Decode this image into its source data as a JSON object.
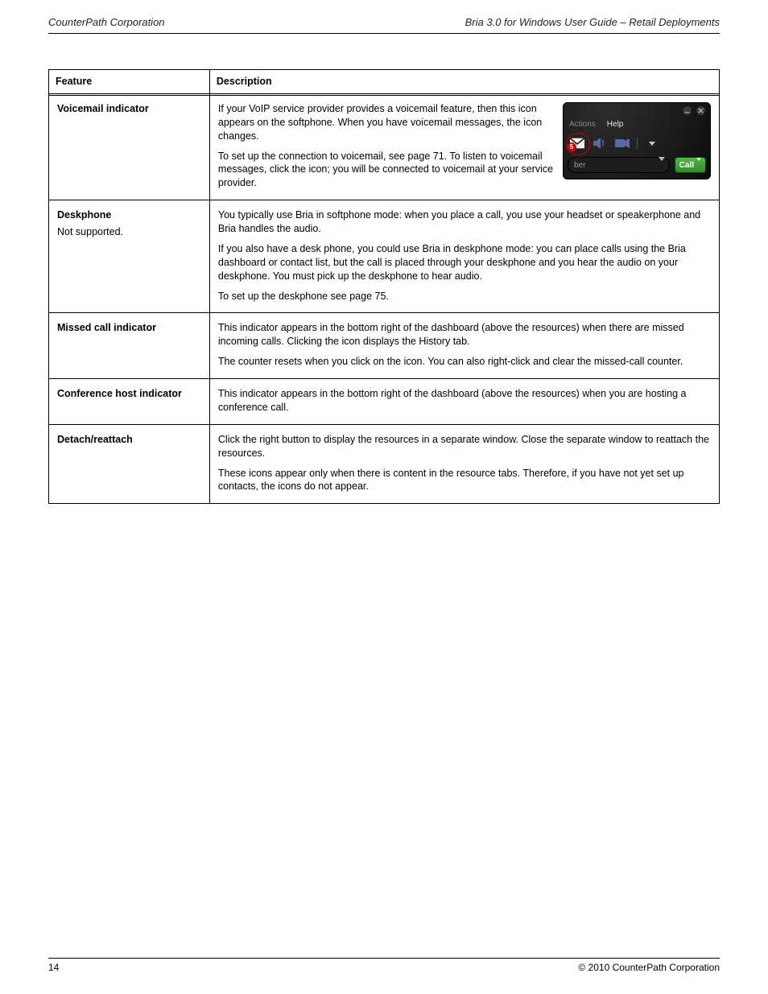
{
  "header": {
    "product": "CounterPath Corporation",
    "running_title": "Bria 3.0 for Windows User Guide – Retail Deployments"
  },
  "table": {
    "headers": {
      "feature": "Feature",
      "description": "Description"
    },
    "rows": [
      {
        "feature_title": "Voicemail indicator",
        "feature_body": "",
        "desc_paragraphs": [
          "If your VoIP service provider provides a voicemail feature, then this icon appears on the softphone. When you have voicemail messages, the icon changes.",
          "To set up the connection to voicemail, see page 71. To listen to voicemail messages, click the icon; you will be connected to voicemail at your service provider."
        ]
      },
      {
        "feature_title": "Deskphone",
        "feature_body": "Not supported.",
        "desc_paragraphs": [
          "You typically use Bria in softphone mode: when you place a call, you use your headset or speakerphone and Bria handles the audio.",
          "If you also have a desk phone, you could use Bria in deskphone mode: you can place calls using the Bria dashboard or contact list, but the call is placed through your deskphone and you hear the audio on your deskphone. You must pick up the deskphone to hear audio.",
          "To set up the deskphone see page 75."
        ]
      },
      {
        "feature_title": "Missed call indicator",
        "feature_body": "",
        "desc_paragraphs": [
          "This indicator appears in the bottom right of the dashboard (above the resources) when there are missed incoming calls. Clicking the icon displays the History tab.",
          "The counter resets when you click on the icon. You can also right-click and clear the missed-call counter."
        ]
      },
      {
        "feature_title": "Conference host indicator",
        "feature_body": "",
        "desc_paragraphs": [
          "This indicator appears in the bottom right of the dashboard (above the resources) when you are hosting a conference call."
        ]
      },
      {
        "feature_title": "Detach/reattach",
        "feature_body": "",
        "desc_paragraphs": [
          "Click the right button to display the resources in a separate window. Close the separate window to reattach the resources.",
          "These icons appear only when there is content in the resource tabs. Therefore, if you have not yet set up contacts, the icons do not appear."
        ]
      }
    ]
  },
  "screenshot": {
    "menu": {
      "actions": "Actions",
      "help": "Help"
    },
    "badge_count": "5",
    "field_partial": "ber",
    "call_label": "Call"
  },
  "footer": {
    "page_number": "14",
    "copyright": "© 2010 CounterPath Corporation"
  }
}
